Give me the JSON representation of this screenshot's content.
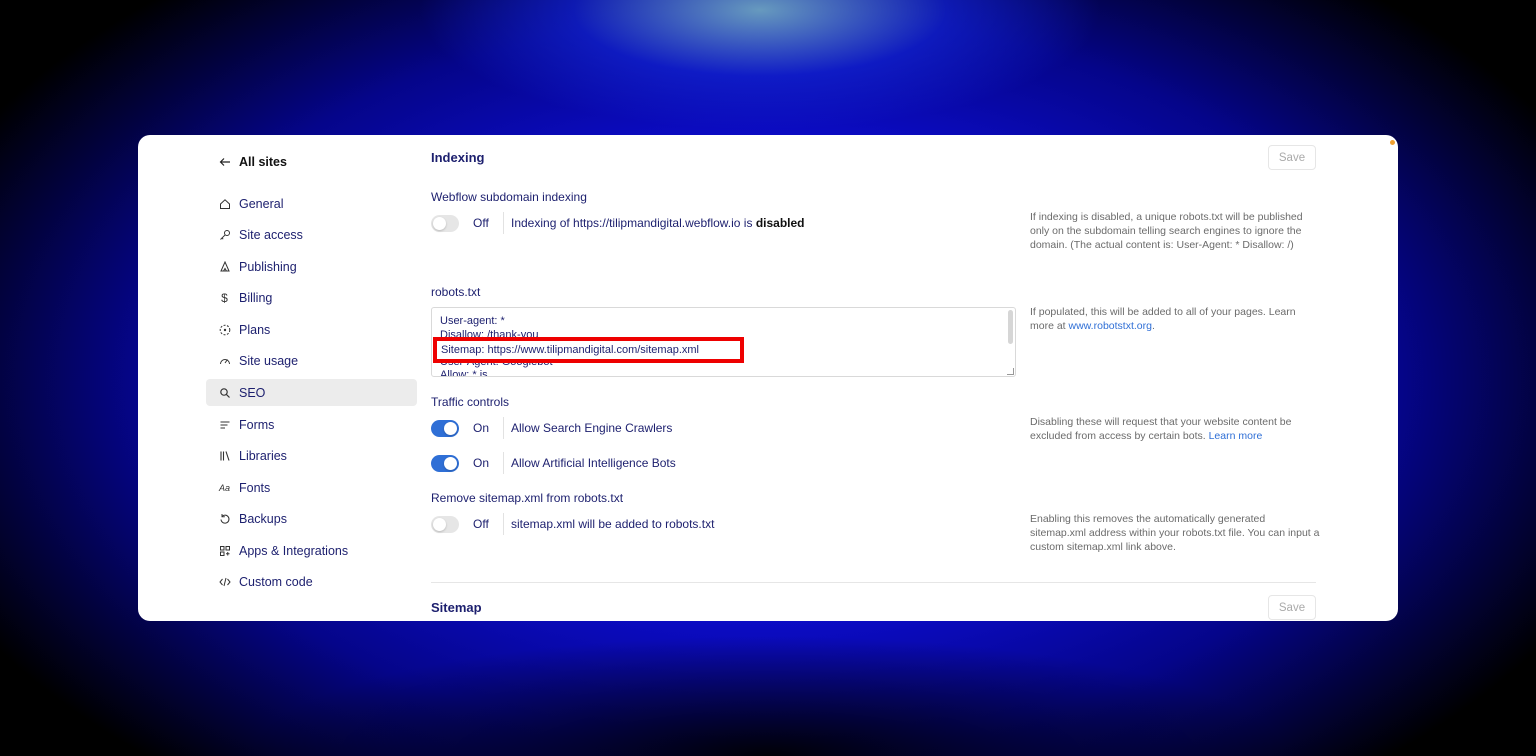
{
  "sidebar": {
    "back_label": "All sites",
    "items": [
      {
        "label": "General",
        "icon": "home-icon"
      },
      {
        "label": "Site access",
        "icon": "key-icon"
      },
      {
        "label": "Publishing",
        "icon": "rocket-icon"
      },
      {
        "label": "Billing",
        "icon": "dollar-icon"
      },
      {
        "label": "Plans",
        "icon": "plans-icon"
      },
      {
        "label": "Site usage",
        "icon": "gauge-icon"
      },
      {
        "label": "SEO",
        "icon": "search-icon",
        "active": true
      },
      {
        "label": "Forms",
        "icon": "forms-icon"
      },
      {
        "label": "Libraries",
        "icon": "libraries-icon"
      },
      {
        "label": "Fonts",
        "icon": "fonts-icon"
      },
      {
        "label": "Backups",
        "icon": "backup-icon"
      },
      {
        "label": "Apps & Integrations",
        "icon": "apps-icon"
      },
      {
        "label": "Custom code",
        "icon": "code-icon"
      }
    ]
  },
  "indexing": {
    "title": "Indexing",
    "save_label": "Save",
    "subdomain_label": "Webflow subdomain indexing",
    "subdomain_state": "Off",
    "subdomain_text": "Indexing of https://tilipmandigital.webflow.io is ",
    "subdomain_text_bold": "disabled",
    "subdomain_help": "If indexing is disabled, a unique robots.txt will be published only on the subdomain telling search engines to ignore the domain. (The actual content is: User-Agent: * Disallow: /)",
    "robots_label": "robots.txt",
    "robots_lines": [
      "User-agent: *",
      "Disallow: /thank-you",
      "Sitemap: https://www.tilipmandigital.com/sitemap.xml",
      "User-Agent: Googlebot",
      "Allow: *.js"
    ],
    "robots_help_prefix": "If populated, this will be added to all of your pages. Learn more at ",
    "robots_help_link": "www.robotstxt.org",
    "robots_help_suffix": ".",
    "traffic_label": "Traffic controls",
    "crawlers_state": "On",
    "crawlers_text": "Allow Search Engine Crawlers",
    "ai_state": "On",
    "ai_text": "Allow Artificial Intelligence Bots",
    "traffic_help_prefix": "Disabling these will request that your website content be excluded from access by certain bots. ",
    "traffic_help_link": "Learn more",
    "remove_sitemap_label": "Remove sitemap.xml from robots.txt",
    "remove_sitemap_state": "Off",
    "remove_sitemap_text": "sitemap.xml will be added to robots.txt",
    "remove_sitemap_help": "Enabling this removes the automatically generated sitemap.xml address within your robots.txt file. You can input a custom sitemap.xml link above."
  },
  "sitemap": {
    "title": "Sitemap",
    "save_label": "Save"
  },
  "colors": {
    "accent": "#2f6fd6",
    "highlight_border": "#ee0000",
    "text_navy": "#1c1f6e"
  }
}
